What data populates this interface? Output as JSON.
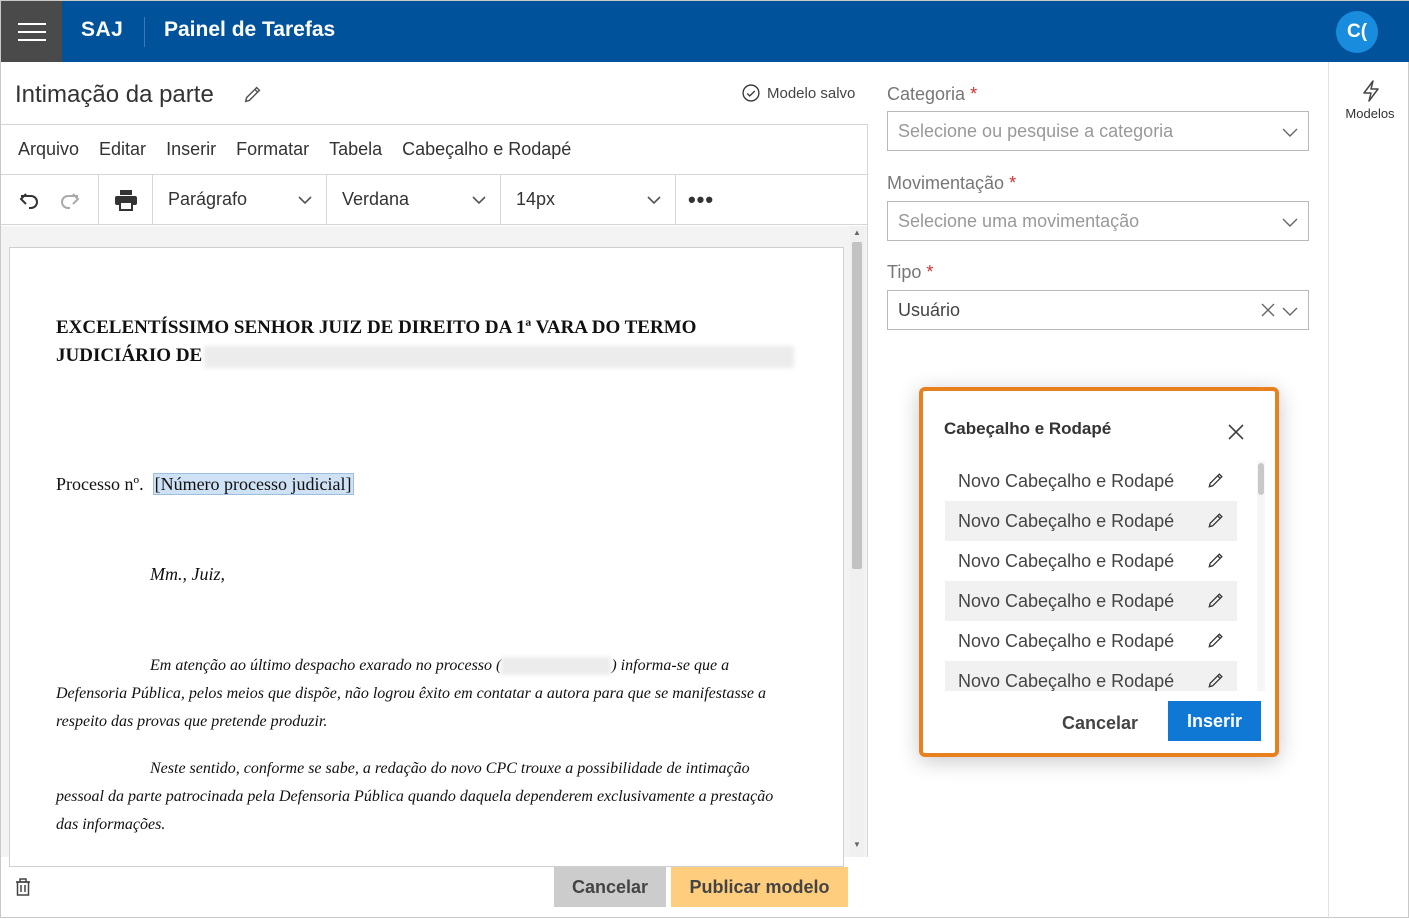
{
  "topbar": {
    "brand": "SAJ",
    "title": "Painel de Tarefas",
    "avatar_initials": "C("
  },
  "editor": {
    "doc_title": "Intimação da parte",
    "saved_status": "Modelo salvo",
    "menu": [
      "Arquivo",
      "Editar",
      "Inserir",
      "Formatar",
      "Tabela",
      "Cabeçalho e Rodapé"
    ],
    "toolbar": {
      "paragraph": "Parágrafo",
      "font": "Verdana",
      "size": "14px",
      "more": "•••"
    },
    "document": {
      "heading_line1": "EXCELENTÍSSIMO SENHOR JUIZ DE DIREITO DA 1ª VARA DO TERMO",
      "heading_line2": "JUDICIÁRIO DE",
      "process_label": "Processo nº.",
      "process_placeholder": "[Número processo judicial]",
      "salutation": "Mm., Juiz,",
      "para1_a": "Em atenção ao último despacho exarado no processo (",
      "para1_b": ") informa-se que a",
      "para1_line2": "Defensoria Pública, pelos meios que dispõe, não logrou êxito em contatar a autora para que se manifestasse a",
      "para1_line3": "respeito das provas que pretende produzir.",
      "para2_line1": "Neste sentido, conforme se sabe, a redação do novo CPC trouxe a possibilidade de intimação",
      "para2_line2": "pessoal da parte patrocinada pela Defensoria Pública quando daquela dependerem exclusivamente a prestação",
      "para2_line3": "das informações."
    },
    "footer": {
      "cancel": "Cancelar",
      "publish": "Publicar modelo"
    }
  },
  "form": {
    "categoria_label": "Categoria",
    "categoria_placeholder": "Selecione ou pesquise a categoria",
    "movimentacao_label": "Movimentação",
    "movimentacao_placeholder": "Selecione uma movimentação",
    "tipo_label": "Tipo",
    "tipo_value": "Usuário",
    "required_mark": "*"
  },
  "rail": {
    "modelos_label": "Modelos"
  },
  "modal": {
    "title": "Cabeçalho e Rodapé",
    "items": [
      "Novo Cabeçalho e Rodapé",
      "Novo Cabeçalho e Rodapé",
      "Novo Cabeçalho e Rodapé",
      "Novo Cabeçalho e Rodapé",
      "Novo Cabeçalho e Rodapé",
      "Novo Cabeçalho e Rodapé"
    ],
    "cancel": "Cancelar",
    "insert": "Inserir",
    "border_color": "#e9801f",
    "insert_color": "#0f78d4"
  },
  "colors": {
    "topbar": "#00539b",
    "publish_button": "#ffcd7e",
    "required": "#d32f2f"
  }
}
